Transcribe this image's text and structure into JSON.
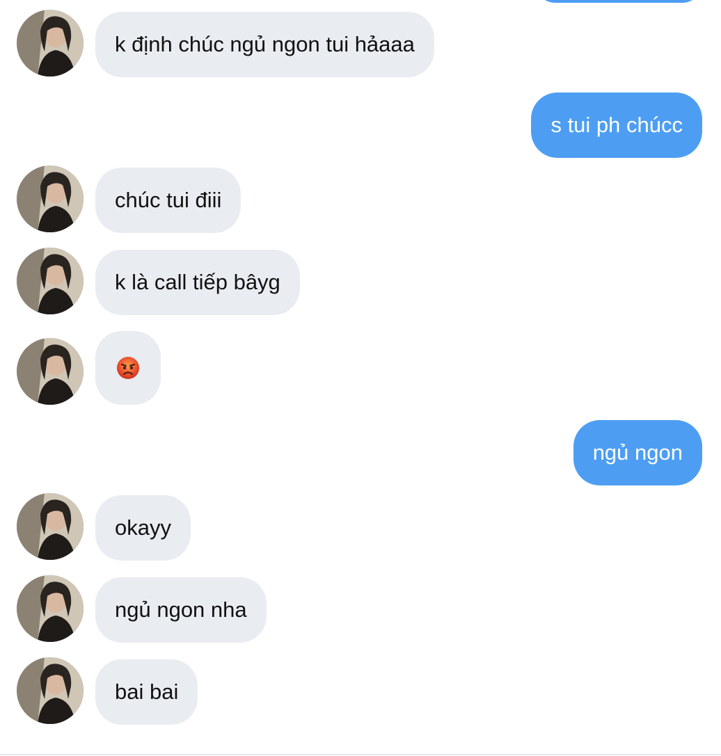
{
  "conversation": {
    "messages": [
      {
        "from": "them",
        "text": "k định chúc ngủ ngon tui hảaaa"
      },
      {
        "from": "me",
        "text": "s tui ph chúcc"
      },
      {
        "from": "them",
        "text": "chúc tui điii"
      },
      {
        "from": "them",
        "text": "k là call tiếp bâyg"
      },
      {
        "from": "them",
        "emoji": "pouting-face-emoji"
      },
      {
        "from": "me",
        "text": "ngủ ngon"
      },
      {
        "from": "them",
        "text": "okayy"
      },
      {
        "from": "them",
        "text": "ngủ ngon nha"
      },
      {
        "from": "them",
        "text": "bai bai"
      }
    ]
  },
  "colors": {
    "outgoing_bubble": "#4d9ef2",
    "incoming_bubble": "#e9ecf1",
    "incoming_text": "#111111",
    "outgoing_text": "#ffffff"
  }
}
